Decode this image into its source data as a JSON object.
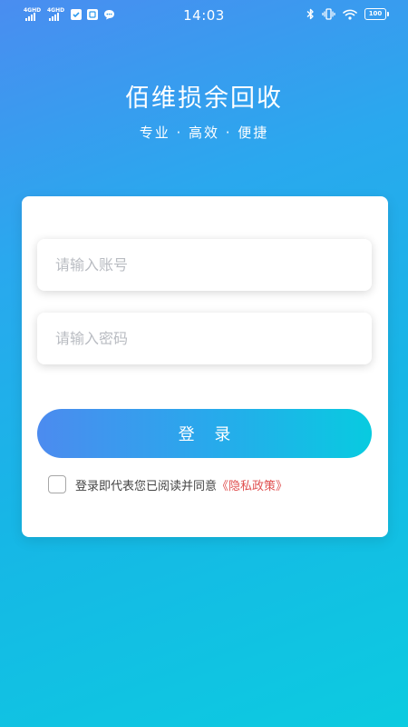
{
  "status_bar": {
    "signal_1": "4GHD",
    "signal_2": "4GHD",
    "time": "14:03",
    "battery": "100",
    "icons": [
      "sim-icon",
      "nfc-icon",
      "message-icon",
      "bluetooth-icon",
      "vibrate-icon",
      "wifi-icon",
      "battery-icon"
    ]
  },
  "header": {
    "title": "佰维损余回收",
    "slogan": "专业 · 高效 · 便捷"
  },
  "login_form": {
    "account_placeholder": "请输入账号",
    "account_value": "",
    "password_placeholder": "请输入密码",
    "password_value": "",
    "login_label": "登 录",
    "agree_checked": false,
    "agree_text": "登录即代表您已阅读并同意",
    "privacy_link": "《隐私政策》"
  },
  "colors": {
    "bg_start": "#4a8df0",
    "bg_end": "#0ccbe0",
    "button_start": "#4c8bef",
    "button_end": "#08cbe0",
    "link": "#e05050",
    "placeholder": "#b9bcc2"
  }
}
